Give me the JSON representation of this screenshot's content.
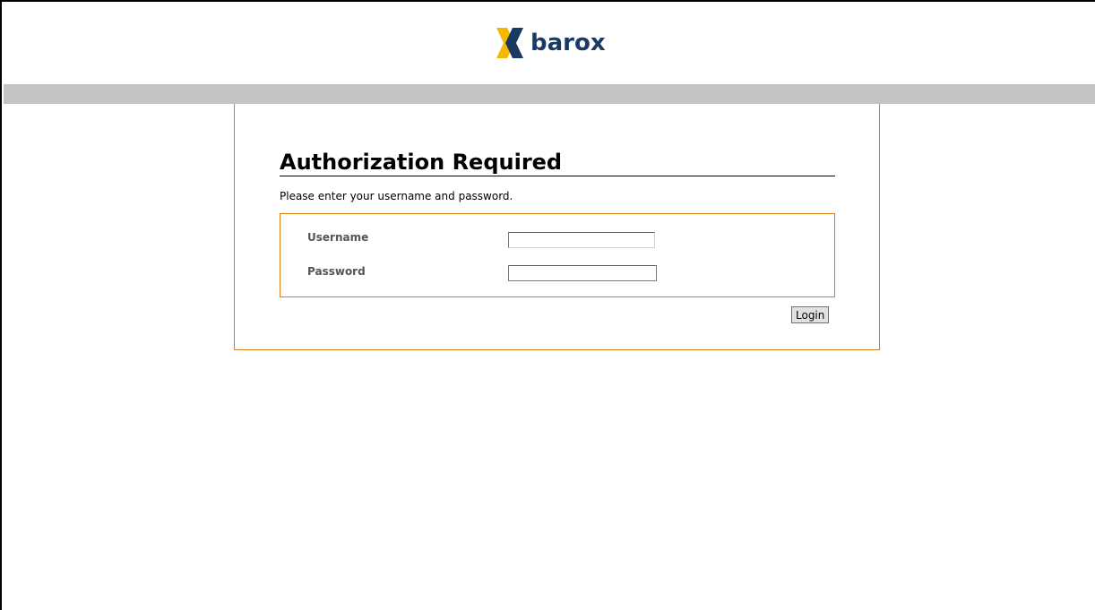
{
  "brand": {
    "name": "barox",
    "logo_icon": "barox-x-logo",
    "colors": {
      "logo_yellow": "#f5b800",
      "logo_navy": "#1b3a63",
      "accent_orange": "#e07b1c",
      "header_bar_grey": "#c3c3c3"
    }
  },
  "auth": {
    "title": "Authorization Required",
    "description": "Please enter your username and password.",
    "username_label": "Username",
    "username_value": "",
    "password_label": "Password",
    "password_value": "",
    "login_label": "Login"
  }
}
